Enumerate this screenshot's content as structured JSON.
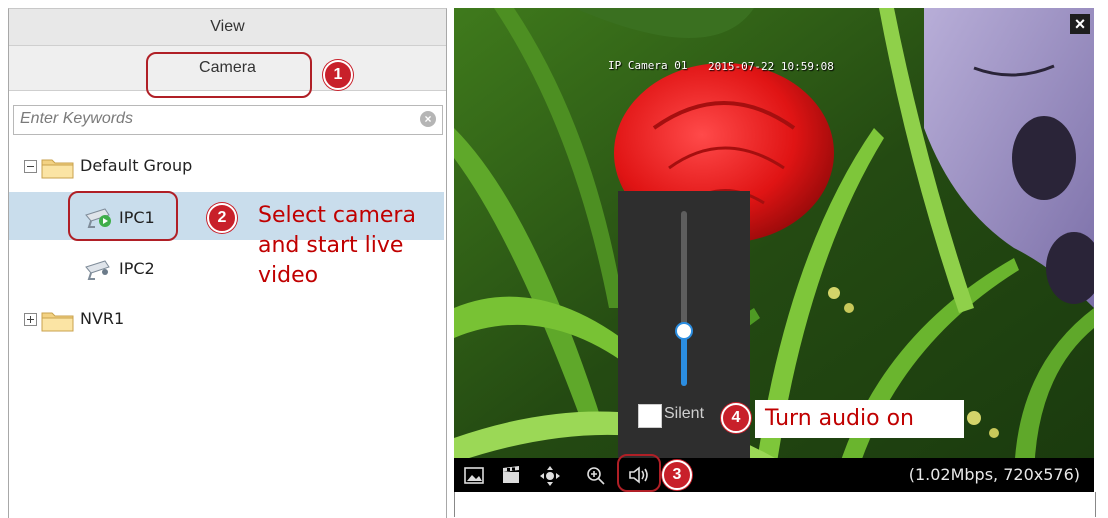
{
  "panel": {
    "view_tab": "View",
    "camera_tab": "Camera",
    "search_placeholder": "Enter Keywords"
  },
  "tree": {
    "default_group": "Default Group",
    "ipc1": "IPC1",
    "ipc2": "IPC2",
    "nvr1": "NVR1"
  },
  "video": {
    "osd_camera": "IP Camera 01",
    "osd_time": "2015-07-22 10:59:08",
    "silent_label": "Silent",
    "volume_level": 0.35,
    "status": "(1.02Mbps, 720x576)"
  },
  "callouts": {
    "n1": "1",
    "n2": "2",
    "n3": "3",
    "n4": "4",
    "step2_text": "Select camera and start live video",
    "step4_text": "Turn audio on"
  },
  "colors": {
    "callout_red": "#c8202a",
    "selected_row": "#c9ddec",
    "slider_blue": "#2b8de0"
  },
  "icons": [
    "close-icon",
    "snapshot-icon",
    "record-icon",
    "ptz-icon",
    "zoom-icon",
    "speaker-icon",
    "folder-icon",
    "camera-icon",
    "clear-icon"
  ]
}
